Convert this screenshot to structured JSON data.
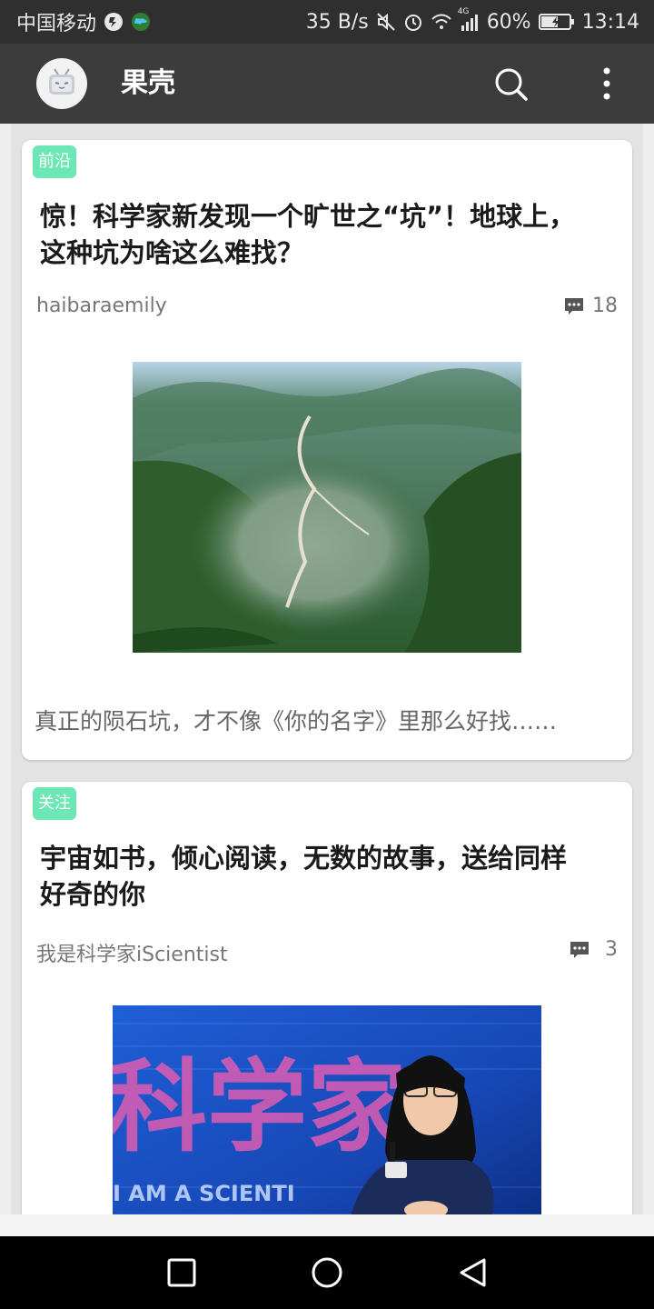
{
  "status_bar": {
    "carrier": "中国移动",
    "network_speed": "35 B/s",
    "network_type": "4G",
    "battery": "60%",
    "time": "13:14",
    "icons": [
      "carrier-extra-icon",
      "globe-icon",
      "mute-icon",
      "alarm-icon",
      "wifi-icon",
      "signal-icon",
      "battery-charging-icon"
    ]
  },
  "app_bar": {
    "title": "果壳",
    "avatar_icon": "bilibili-tv-avatar",
    "actions": [
      "search-icon",
      "more-vert-icon"
    ]
  },
  "feed": {
    "cards": [
      {
        "tag": "前沿",
        "tag_color": "#6ee7b7",
        "title": "惊！科学家新发现一个旷世之“坑”！地球上，这种坑为啥这么难找？",
        "author": "haibaraemily",
        "comment_count": "18",
        "image": "aerial view of a crater valley",
        "excerpt": "真正的陨石坑，才不像《你的名字》里那么好找……"
      },
      {
        "tag": "关注",
        "tag_color": "#6ee7b7",
        "title": "宇宙如书，倾心阅读，无数的故事，送给同样好奇的你",
        "author": "我是科学家iScientist",
        "comment_count": "3",
        "image": "woman speaking on a stage",
        "image_text_large": "科学家",
        "image_text_small": "I AM A SCIENTI"
      }
    ]
  },
  "nav_bar": {
    "buttons": [
      "recent-apps-icon",
      "home-icon",
      "back-icon"
    ]
  }
}
